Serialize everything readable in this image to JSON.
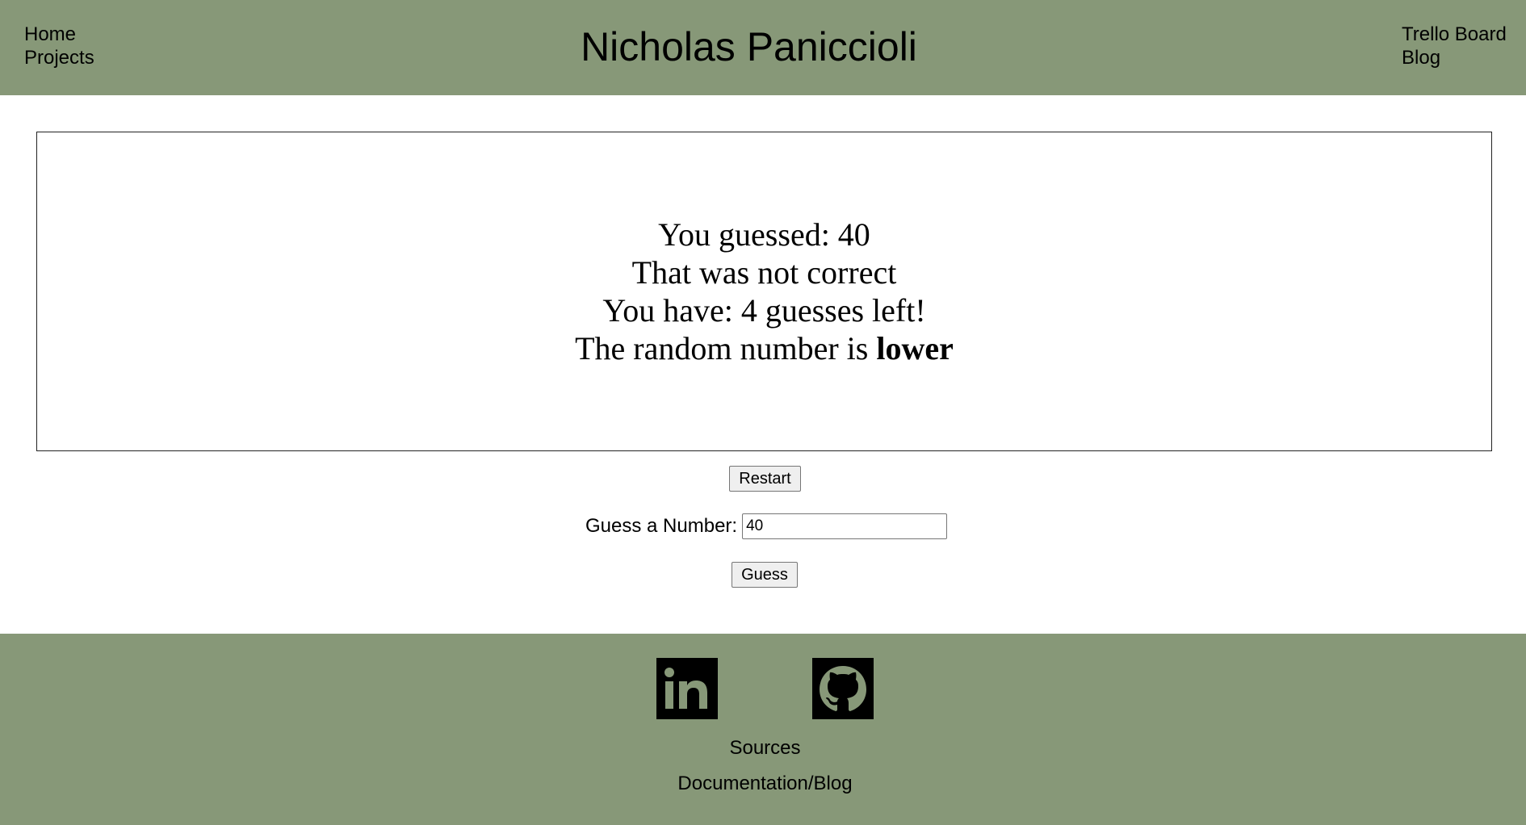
{
  "header": {
    "title": "Nicholas Paniccioli",
    "nav_left": [
      "Home",
      "Projects"
    ],
    "nav_right": [
      "Trello Board",
      "Blog"
    ],
    "background_color": "#879878"
  },
  "game": {
    "line1": "You guessed: 40",
    "line2": "That was not correct",
    "line3": "You have: 4 guesses left!",
    "line4_prefix": "The random number is ",
    "line4_emphasis": "lower"
  },
  "controls": {
    "restart_label": "Restart",
    "guess_label": "Guess a Number:",
    "guess_value": "40",
    "guess_button": "Guess"
  },
  "footer": {
    "icons": [
      "linkedin-icon",
      "github-icon"
    ],
    "sources": "Sources",
    "docs": "Documentation/Blog",
    "background_color": "#879878"
  }
}
